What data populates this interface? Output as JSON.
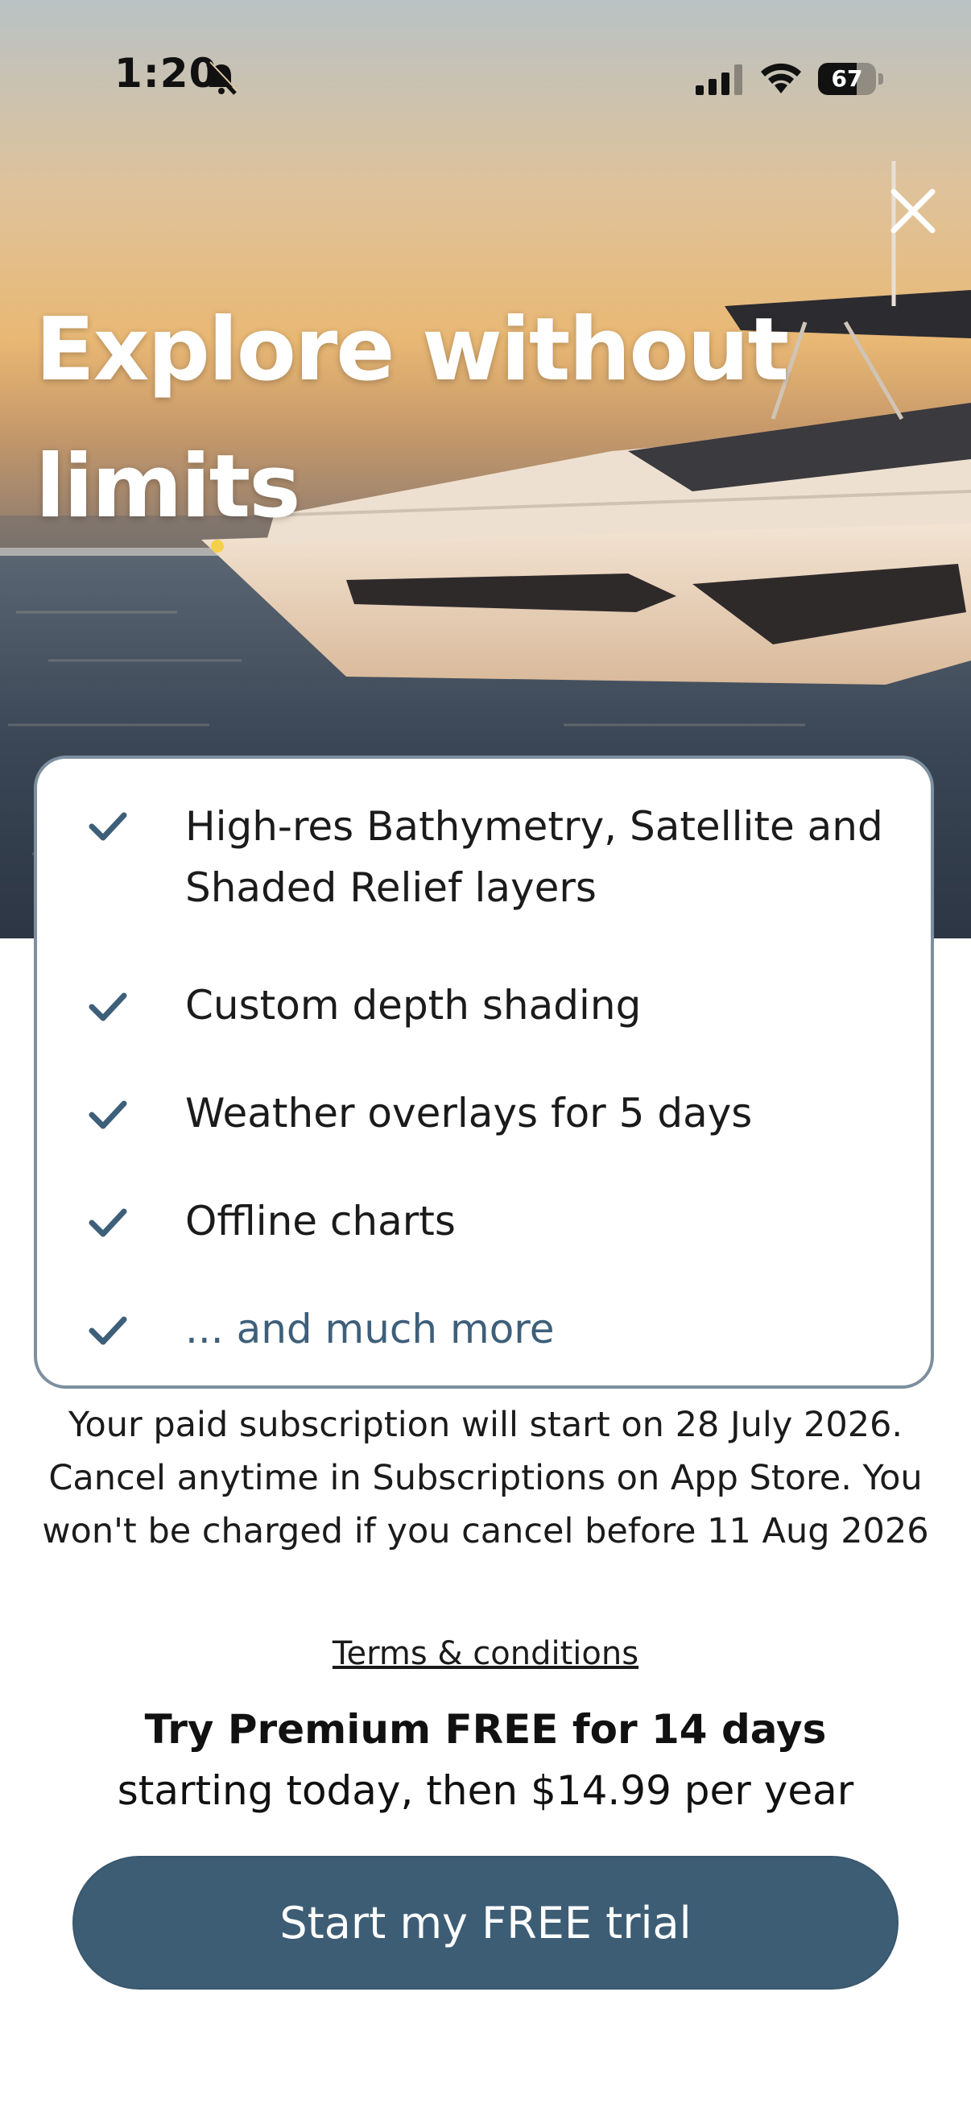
{
  "status_bar": {
    "time": "1:20",
    "battery_level": "67",
    "battery_fraction": 0.67,
    "icons": [
      "bell-slash-icon",
      "cellular-signal-icon",
      "wifi-icon",
      "battery-icon"
    ]
  },
  "hero": {
    "headline": "Explore without limits",
    "close_icon": "close-icon",
    "colors": {
      "sky_top": "#b9c2c4",
      "sky_glow": "#e9b874",
      "sea": "#3a4655"
    }
  },
  "features": {
    "items": [
      {
        "label": "High-res Bathymetry, Satellite and Shaded Relief layers"
      },
      {
        "label": "Custom depth shading"
      },
      {
        "label": "Weather overlays for 5 days"
      },
      {
        "label": "Offline charts"
      },
      {
        "label": "... and much more"
      }
    ],
    "check_icon": "checkmark-icon",
    "colors": {
      "check": "#3e5f7a",
      "border": "#7d8f9e",
      "more_link": "#3e5f7a"
    }
  },
  "disclaimer": {
    "text": "Your paid subscription will start on 28 July 2026. Cancel anytime in Subscriptions on App Store. You won't be charged if you cancel before 11 Aug 2026"
  },
  "terms_label": "Terms & conditions",
  "offer": {
    "title": "Try Premium FREE for 14 days",
    "subtitle": "starting today, then $14.99 per year"
  },
  "cta": {
    "label": "Start my FREE trial",
    "color": "#3d5d75"
  }
}
